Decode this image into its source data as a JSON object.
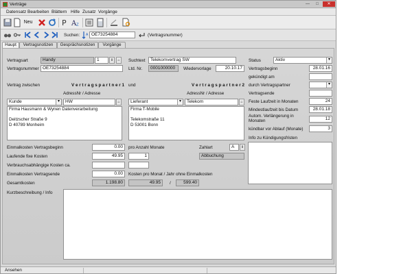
{
  "window": {
    "title": "Verträge"
  },
  "menu": [
    "Datensatz",
    "Bearbeiten",
    "Blättern",
    "Hilfe",
    "Zusatz",
    "Vorgänge"
  ],
  "toolbar": {
    "new_label": "Neu"
  },
  "search": {
    "label": "Suchen:",
    "value": "OE73254884",
    "hint": "(Vertragsnummer)"
  },
  "tabs": [
    "Haupt",
    "Vertragsnotizen",
    "Gesprächsnotizen",
    "Vorgänge"
  ],
  "form": {
    "vertragsart_label": "Vertragsart",
    "vertragsart_value": "Handy",
    "vertragsart_num": "1",
    "vertragsnummer_label": "Vertragsnummer",
    "vertragsnummer_value": "OE73254884",
    "suchtext_label": "Suchtext",
    "suchtext_value": "Telekomvertrag SW",
    "ltd_label": "Ltd. Nr.",
    "ltd_value": "0001000000",
    "wiedervorlage_label": "Wiedervorlage",
    "wiedervorlage_value": "20.10.17",
    "vertrag_zwischen": "Vertrag zwischen",
    "partner1_label": "V e r t r a g s p a r t n e r 1",
    "und_label": "und",
    "partner2_label": "V e r t r a g s p a r t n e r 2",
    "adressnr1_label": "AdressNr / Adresse",
    "adressnr2_label": "AdressNr / Adresse",
    "partner1_role": "Kunde",
    "partner1_code": "HW",
    "partner2_role": "Lieferant",
    "partner2_code": "Telekom",
    "address1": [
      "Firma Hausmann & Wynen Datenverarbeitung",
      "",
      "Deitzscher Straße 9",
      "D 40789 Monheim"
    ],
    "address2": [
      "Firma T-Mobile",
      "",
      "Telekomstraße 11",
      "D 53001 Bonn"
    ],
    "status_label": "Status",
    "status_value": "Aktiv",
    "vertragsbeginn_label": "Vertragsbeginn",
    "vertragsbeginn_value": "28.01.16",
    "gekuendigt_label": "gekündigt am",
    "durch_label": "durch Vertragspartner",
    "vertragsende_label": "Vertragsende",
    "feste_laufzeit_label": "Feste Laufzeit in Monaten",
    "feste_laufzeit_value": "24",
    "mindestlaufzeit_label": "Mindestlaufzeit bis Datum",
    "mindestlaufzeit_value": "28.01.18",
    "autom_label_1": "Autom. Verlängerung in",
    "autom_label_2": "Monaten",
    "autom_value": "12",
    "kuendbar_label": "kündbar vor Ablauf (Monate)",
    "kuendbar_value": "3",
    "info_fristen_label": "Info zu Kündigungsfristen",
    "einmal_beginn_label": "Einmalkosten Vertragsbeginn",
    "einmal_beginn_value": "0.00",
    "laufende_label": "Laufende fixe Kosten",
    "laufende_value": "49.95",
    "verbrauch_label": "Verbrauchsabhängige Kosten ca.",
    "einmal_ende_label": "Einmalkosten Vertragsende",
    "einmal_ende_value": "0.00",
    "gesamt_label": "Gesamtkosten",
    "gesamt_value": "1.198.80",
    "pro_anzahl_label": "pro Anzahl Monate",
    "pro_anzahl_value": "1",
    "zahlart_label": "Zahlart",
    "zahlart_value": "A",
    "zahlart_text": "Abbuchung",
    "kosten_pro_label": "Kosten pro Monat / Jahr ohne Einmalkosten",
    "kosten_monat": "49.95",
    "kosten_sep": "/",
    "kosten_jahr": "599.40",
    "kurz_label": "Kurzbeschreibung / Info"
  },
  "statusbar": {
    "mode": "Ansehen"
  }
}
